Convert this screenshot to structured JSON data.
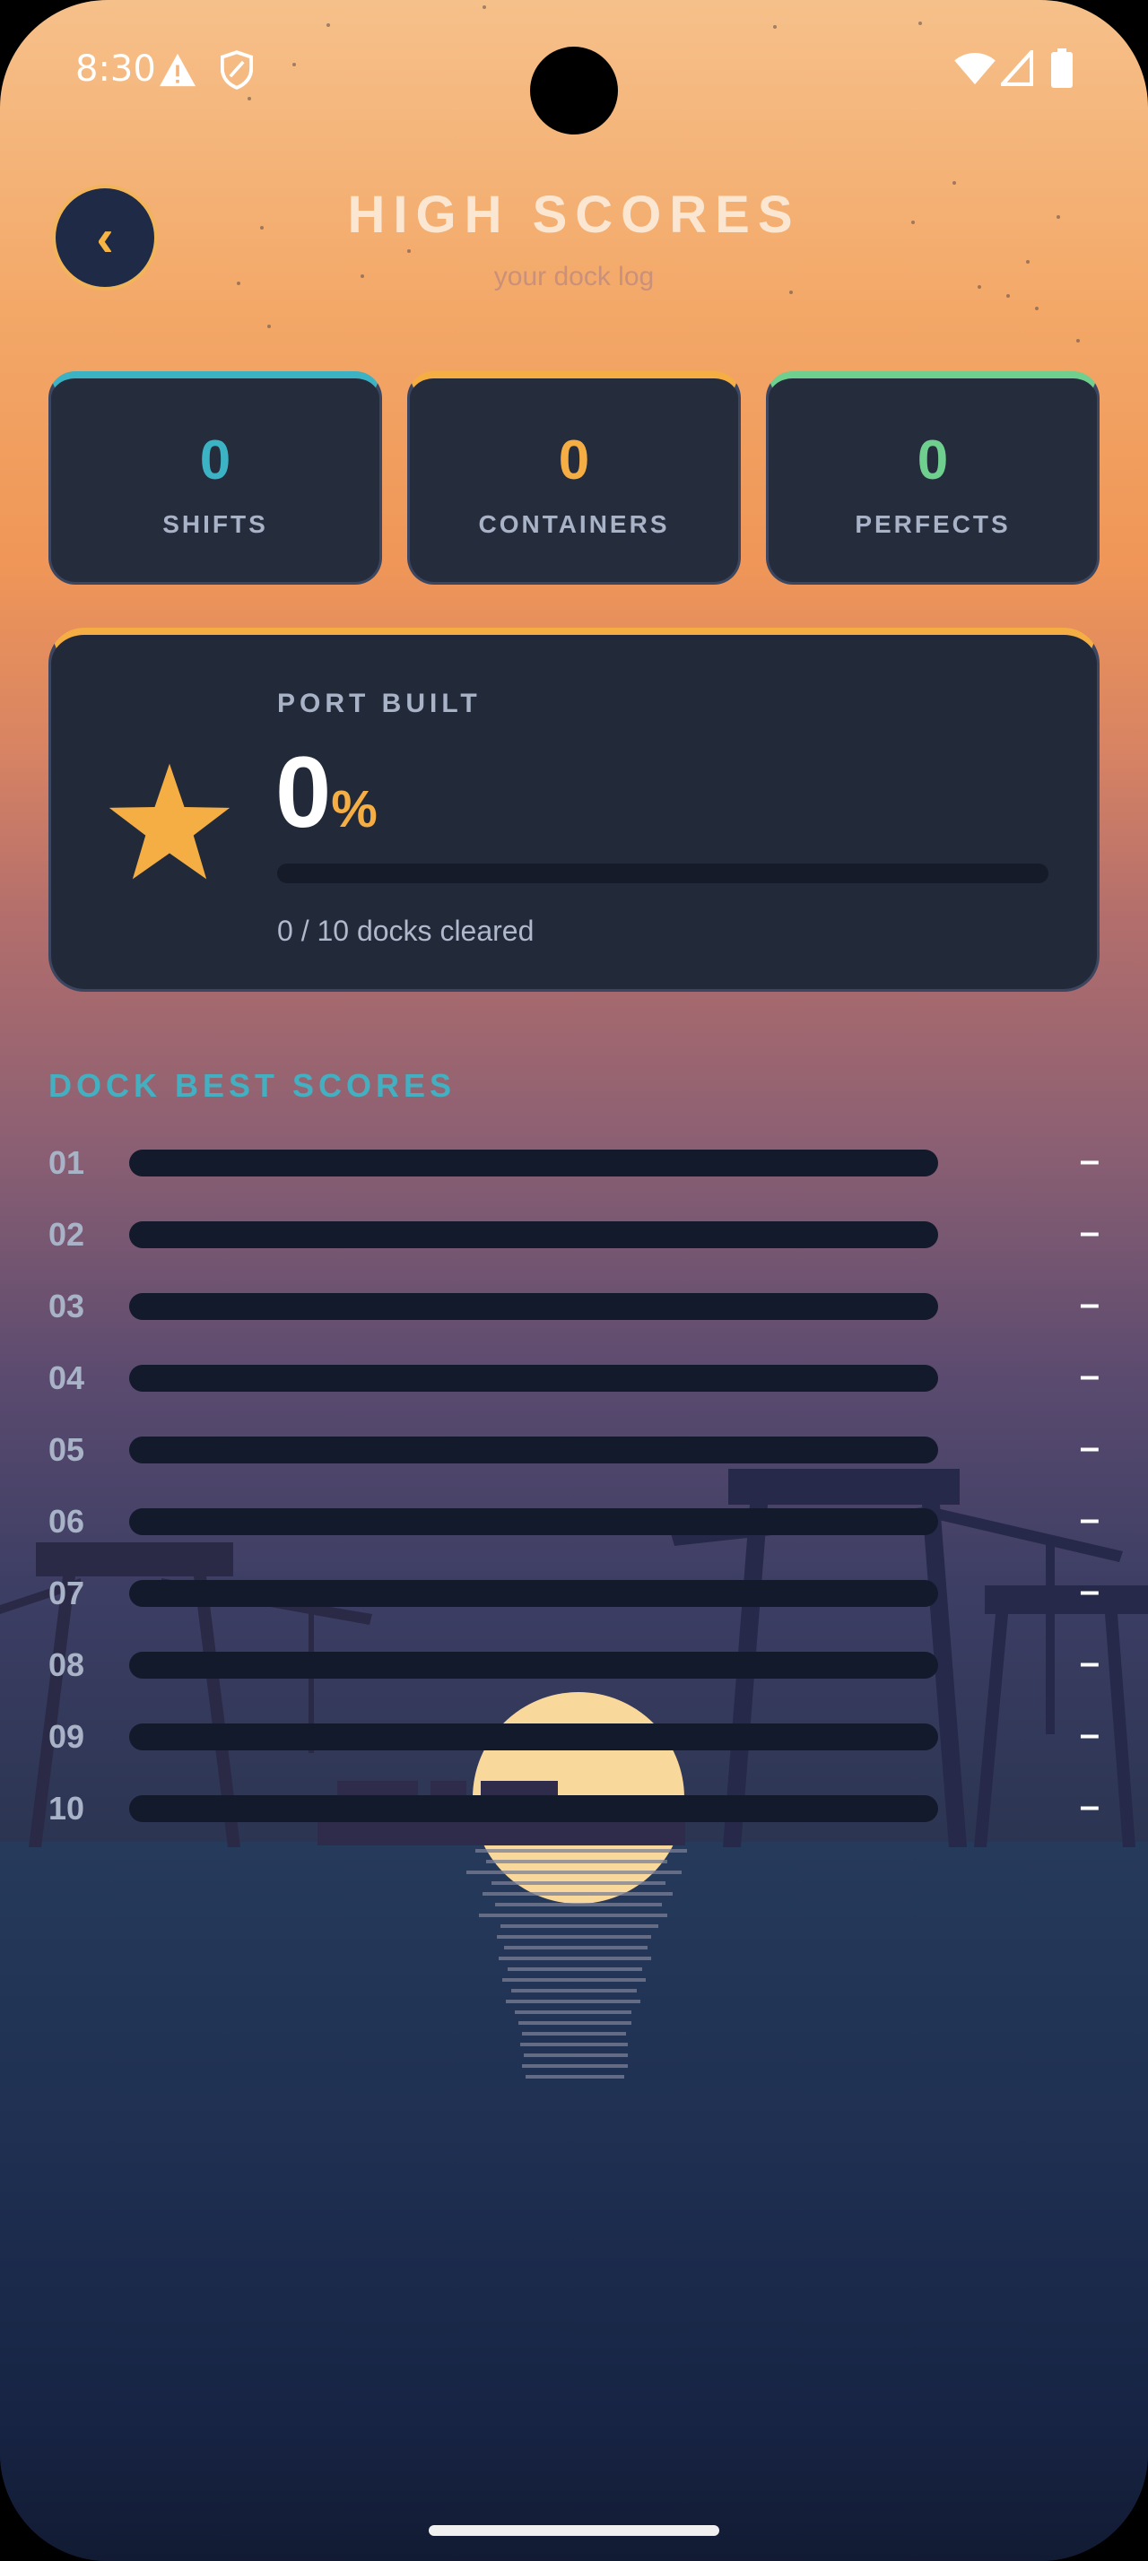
{
  "status_bar": {
    "time": "8:30",
    "icons": [
      "warning-icon",
      "shield-icon",
      "wifi-icon",
      "signal-icon",
      "battery-icon"
    ]
  },
  "header": {
    "back_icon": "chevron-left-icon",
    "back_glyph": "‹",
    "title": "HIGH SCORES",
    "subtitle": "your dock log"
  },
  "stats": [
    {
      "value": "0",
      "label": "SHIFTS",
      "color": "#3cb3c4"
    },
    {
      "value": "0",
      "label": "CONTAINERS",
      "color": "#f5ae44"
    },
    {
      "value": "0",
      "label": "PERFECTS",
      "color": "#6fcf8e"
    }
  ],
  "port": {
    "label": "PORT BUILT",
    "value": "0",
    "unit": "%",
    "progress_fraction": 0,
    "caption": "0 / 10 docks cleared",
    "icon": "star-icon"
  },
  "dock_scores": {
    "title": "DOCK BEST SCORES",
    "rows": [
      {
        "num": "01",
        "score": "–"
      },
      {
        "num": "02",
        "score": "–"
      },
      {
        "num": "03",
        "score": "–"
      },
      {
        "num": "04",
        "score": "–"
      },
      {
        "num": "05",
        "score": "–"
      },
      {
        "num": "06",
        "score": "–"
      },
      {
        "num": "07",
        "score": "–"
      },
      {
        "num": "08",
        "score": "–"
      },
      {
        "num": "09",
        "score": "–"
      },
      {
        "num": "10",
        "score": "–"
      }
    ]
  },
  "colors": {
    "accent_orange": "#f5ae44",
    "accent_teal": "#3cb3c4",
    "accent_green": "#6fcf8e",
    "card_bg": "#222a3a"
  }
}
